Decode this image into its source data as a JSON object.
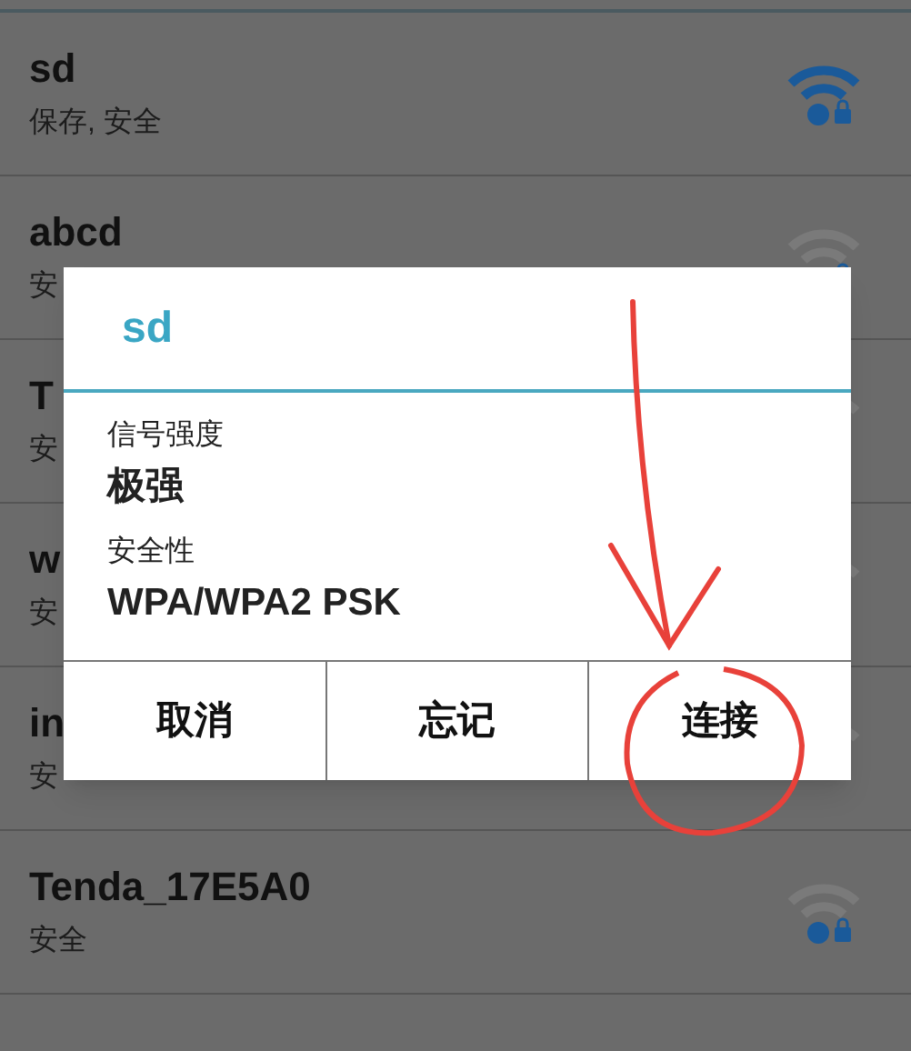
{
  "networks": [
    {
      "name": "sd",
      "status": "保存, 安全",
      "kind": "strong"
    },
    {
      "name": "abcd",
      "status": "安",
      "kind": "weak"
    },
    {
      "name": "T",
      "status": "安",
      "kind": "weak"
    },
    {
      "name": "w",
      "status": "安",
      "kind": "weak"
    },
    {
      "name": "in",
      "status": "安",
      "kind": "weak"
    },
    {
      "name": "Tenda_17E5A0",
      "status": "安全",
      "kind": "weak"
    }
  ],
  "dialog": {
    "title": "sd",
    "fields": [
      {
        "label": "信号强度",
        "value": "极强"
      },
      {
        "label": "安全性",
        "value": "WPA/WPA2 PSK"
      }
    ],
    "buttons": [
      "取消",
      "忘记",
      "连接"
    ]
  }
}
